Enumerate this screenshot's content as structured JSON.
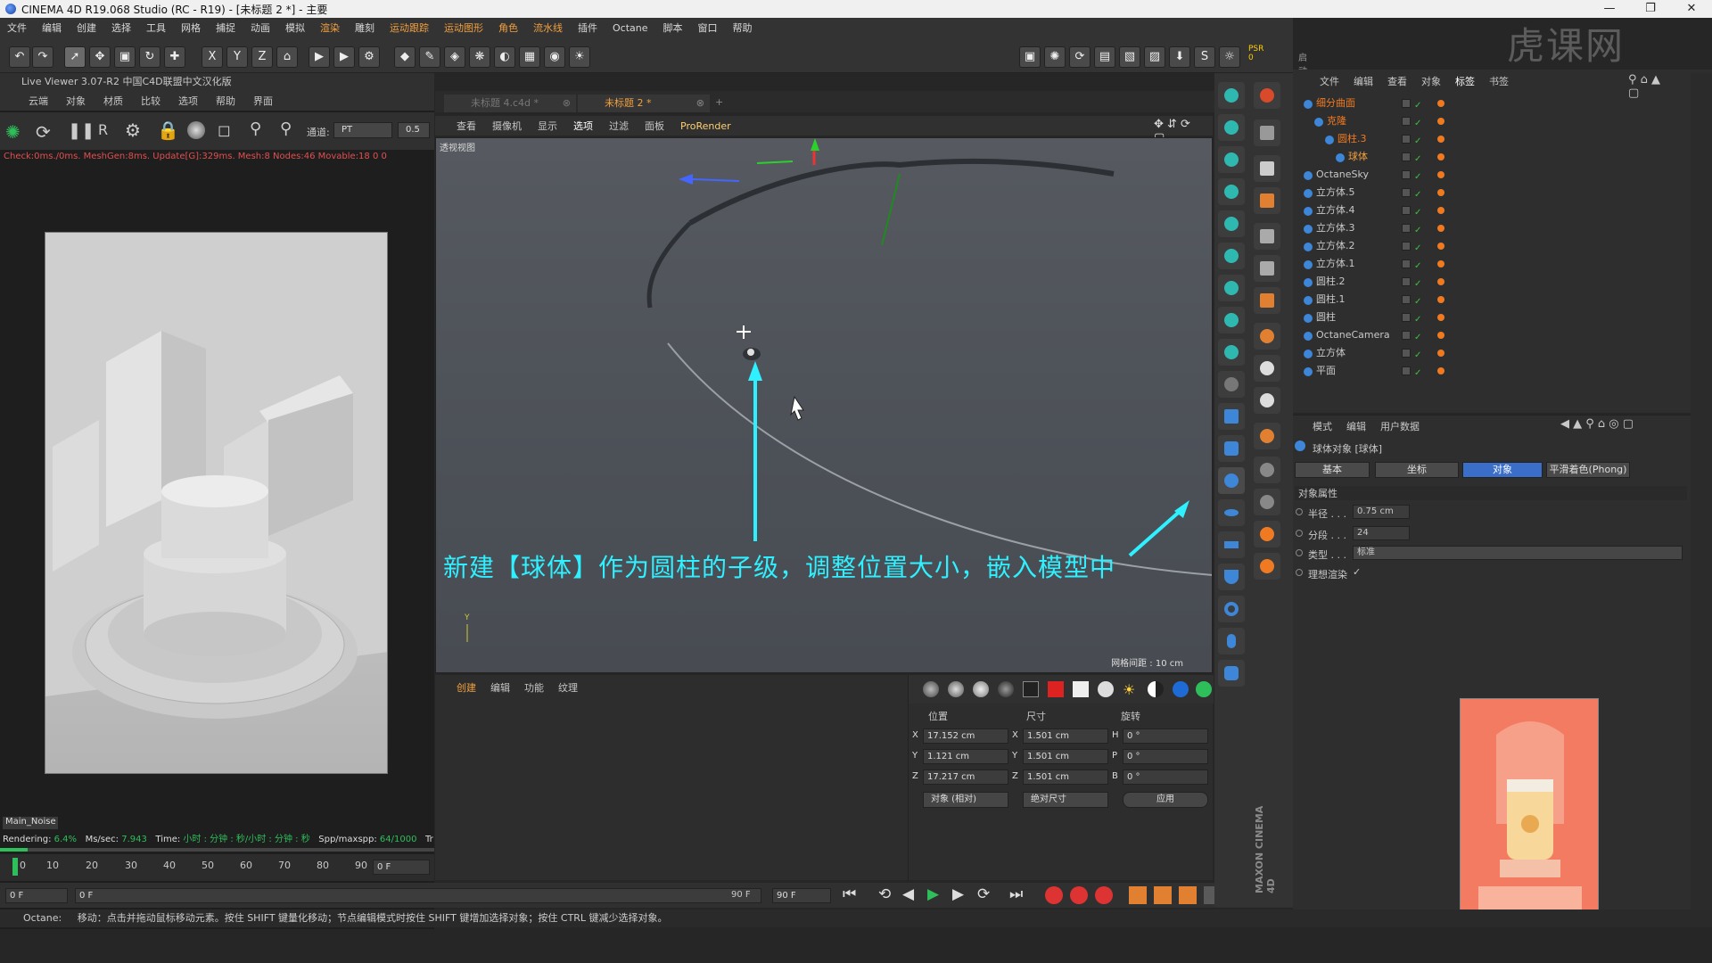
{
  "window": {
    "title": "CINEMA 4D R19.068 Studio (RC - R19) - [未标题 2 *] - 主要",
    "minimize": "—",
    "restore": "❐",
    "close": "✕"
  },
  "watermark": "虎课网",
  "menu": [
    "文件",
    "编辑",
    "创建",
    "选择",
    "工具",
    "网格",
    "捕捉",
    "动画",
    "模拟",
    "渲染",
    "雕刻",
    "运动跟踪",
    "运动图形",
    "角色",
    "流水线",
    "插件",
    "Octane",
    "脚本",
    "窗口",
    "帮助"
  ],
  "layout_label": "启动",
  "live_viewer": {
    "title": "Live Viewer 3.07-R2 中国C4D联盟中文汉化版",
    "menu": [
      "云端",
      "对象",
      "材质",
      "比较",
      "选项",
      "帮助",
      "界面"
    ],
    "channel_label": "通道:",
    "channel": "PT",
    "value": "0.5",
    "status": "Check:0ms./0ms. MeshGen:8ms. Update[G]:329ms. Mesh:8 Nodes:46 Movable:18  0 0",
    "tab": "Main_Noise",
    "render_label": "Rendering:",
    "render_pct": "6.4%",
    "ms_label": "Ms/sec:",
    "ms": "7.943",
    "time_label": "Time:",
    "time": "小时 : 分钟 : 秒/小时 : 分钟 : 秒",
    "spp_label": "Spp/maxspp:",
    "spp": "64/1000",
    "tr": "Tr",
    "progress": 0.064
  },
  "timeline": {
    "ticks": [
      "0",
      "10",
      "20",
      "30",
      "40",
      "50",
      "60",
      "70",
      "80",
      "90"
    ],
    "frame": "0 F",
    "start": "0 F",
    "range_start": "0 F",
    "range_end": "90 F",
    "end": "90 F"
  },
  "tabs": [
    {
      "label": "未标题 4.c4d *",
      "active": false
    },
    {
      "label": "未标题 2 *",
      "active": true
    }
  ],
  "viewport": {
    "menu": [
      "查看",
      "摄像机",
      "显示",
      "选项",
      "过滤",
      "面板",
      "ProRender"
    ],
    "label": "透视视图",
    "grid": "网格间距 : 10 cm",
    "caption": "新建【球体】作为圆柱的子级，调整位置大小，嵌入模型中"
  },
  "create_panel": {
    "menu": [
      "创建",
      "编辑",
      "功能",
      "纹理"
    ]
  },
  "coords": {
    "headers": [
      "位置",
      "尺寸",
      "旋转"
    ],
    "rows": [
      {
        "a": "X",
        "pos": "17.152 cm",
        "b": "X",
        "size": "1.501 cm",
        "c": "H",
        "rot": "0 °"
      },
      {
        "a": "Y",
        "pos": "1.121 cm",
        "b": "Y",
        "size": "1.501 cm",
        "c": "P",
        "rot": "0 °"
      },
      {
        "a": "Z",
        "pos": "17.217 cm",
        "b": "Z",
        "size": "1.501 cm",
        "c": "B",
        "rot": "0 °"
      }
    ],
    "mode": "对象 (相对)",
    "size_mode": "绝对尺寸",
    "apply": "应用"
  },
  "objects": {
    "menu": [
      "文件",
      "编辑",
      "查看",
      "对象",
      "标签",
      "书签"
    ],
    "items": [
      {
        "name": "细分曲面",
        "indent": 0,
        "color": "#f07a22"
      },
      {
        "name": "克隆",
        "indent": 1,
        "color": "#f07a22"
      },
      {
        "name": "圆柱.3",
        "indent": 2,
        "color": "#f07a22"
      },
      {
        "name": "球体",
        "indent": 3,
        "color": "#f0a040"
      },
      {
        "name": "OctaneSky",
        "indent": 0,
        "color": "#c8c8c8"
      },
      {
        "name": "立方体.5",
        "indent": 0,
        "color": "#c8c8c8"
      },
      {
        "name": "立方体.4",
        "indent": 0,
        "color": "#c8c8c8"
      },
      {
        "name": "立方体.3",
        "indent": 0,
        "color": "#c8c8c8"
      },
      {
        "name": "立方体.2",
        "indent": 0,
        "color": "#c8c8c8"
      },
      {
        "name": "立方体.1",
        "indent": 0,
        "color": "#c8c8c8"
      },
      {
        "name": "圆柱.2",
        "indent": 0,
        "color": "#c8c8c8"
      },
      {
        "name": "圆柱.1",
        "indent": 0,
        "color": "#c8c8c8"
      },
      {
        "name": "圆柱",
        "indent": 0,
        "color": "#c8c8c8"
      },
      {
        "name": "OctaneCamera",
        "indent": 0,
        "color": "#c8c8c8"
      },
      {
        "name": "立方体",
        "indent": 0,
        "color": "#c8c8c8"
      },
      {
        "name": "平面",
        "indent": 0,
        "color": "#c8c8c8"
      }
    ]
  },
  "attributes": {
    "menu": [
      "模式",
      "编辑",
      "用户数据"
    ],
    "object_title": "球体对象 [球体]",
    "tabs": [
      "基本",
      "坐标",
      "对象",
      "平滑着色(Phong)"
    ],
    "active_tab": "对象",
    "section": "对象属性",
    "props": [
      {
        "label": "半径 . . .",
        "value": "0.75 cm"
      },
      {
        "label": "分段 . . .",
        "value": "24"
      },
      {
        "label": "类型 . . .",
        "value": "标准"
      },
      {
        "label": "理想渲染",
        "value": "✓"
      }
    ]
  },
  "statusbar": {
    "label": "Octane:",
    "text": "移动：点击并拖动鼠标移动元素。按住 SHIFT 键量化移动；节点编辑模式时按住 SHIFT 键增加选择对象；按住 CTRL 键减少选择对象。"
  },
  "brand": "MAXON CINEMA 4D",
  "psr": "PSR",
  "psr_val": "0"
}
